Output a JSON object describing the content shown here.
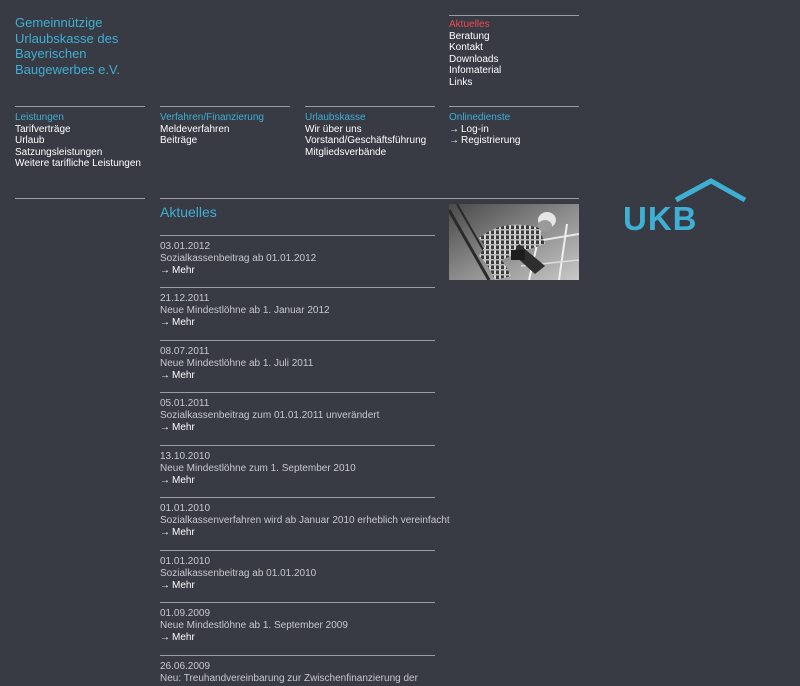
{
  "organization": {
    "name_lines": [
      "Gemeinnützige",
      "Urlaubskasse des",
      "Bayerischen",
      "Baugewerbes e.V."
    ]
  },
  "top_nav": [
    {
      "label": "Aktuelles",
      "active": true
    },
    {
      "label": "Beratung"
    },
    {
      "label": "Kontakt"
    },
    {
      "label": "Downloads"
    },
    {
      "label": "Infomaterial"
    },
    {
      "label": "Links"
    }
  ],
  "main_nav": [
    {
      "title": "Leistungen",
      "items": [
        "Tarifverträge",
        "Urlaub",
        "Satzungsleistungen",
        "Weitere tarifliche Leistungen"
      ]
    },
    {
      "title": "Verfahren/Finanzierung",
      "items": [
        "Meldeverfahren",
        "Beiträge"
      ]
    },
    {
      "title": "Urlaubskasse",
      "items": [
        "Wir über uns",
        "Vorstand/Geschäftsführung",
        "Mitgliedsverbände"
      ]
    },
    {
      "title": "Onlinedienste",
      "items": [
        "Log-in",
        "Registrierung"
      ]
    }
  ],
  "section_title": "Aktuelles",
  "more_label": "Mehr",
  "news": [
    {
      "date": "03.01.2012",
      "title": "Sozialkassenbeitrag ab 01.01.2012"
    },
    {
      "date": "21.12.2011",
      "title": "Neue Mindestlöhne ab 1. Januar 2012"
    },
    {
      "date": "08.07.2011",
      "title": "Neue Mindestlöhne ab 1. Juli 2011"
    },
    {
      "date": "05.01.2011",
      "title": "Sozialkassenbeitrag zum 01.01.2011 unverändert"
    },
    {
      "date": "13.10.2010",
      "title": "Neue Mindestlöhne zum 1. September 2010"
    },
    {
      "date": "01.01.2010",
      "title": "Sozialkassenverfahren wird ab Januar 2010 erheblich vereinfacht"
    },
    {
      "date": "01.01.2010",
      "title": "Sozialkassenbeitrag ab 01.01.2010"
    },
    {
      "date": "01.09.2009",
      "title": "Neue Mindestlöhne ab 1. September 2009"
    },
    {
      "date": "26.06.2009",
      "title": "Neu: Treuhandvereinbarung zur Zwischenfinanzierung der"
    }
  ],
  "logo_text": "UKB",
  "colors": {
    "background": "#383a44",
    "accent": "#3fb0d3",
    "active": "#ef4a4e"
  }
}
